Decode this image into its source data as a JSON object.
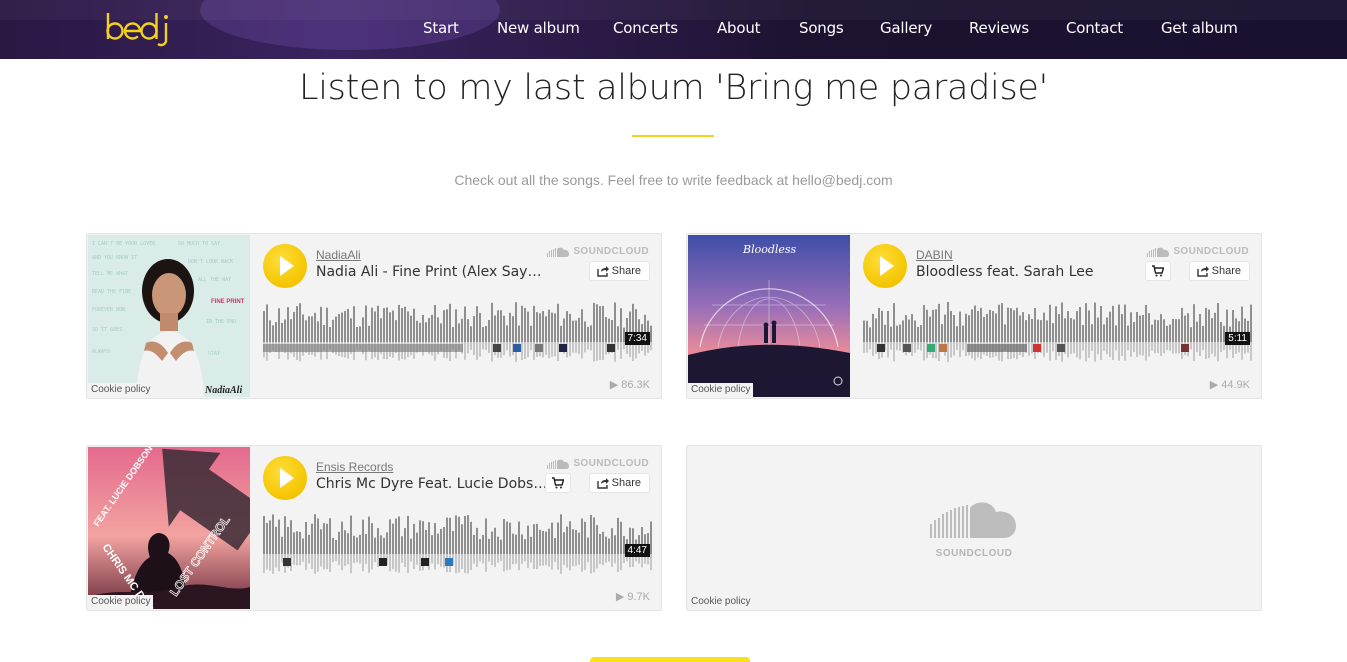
{
  "header": {
    "logo_text": "bedj",
    "nav": [
      "Start",
      "New album",
      "Concerts",
      "About",
      "Songs",
      "Gallery",
      "Reviews",
      "Contact",
      "Get album"
    ]
  },
  "section": {
    "title": "Listen to my last album 'Bring me paradise'",
    "subtitle": "Check out all the songs. Feel free to write feedback at hello@bedj.com"
  },
  "players": [
    {
      "artist": "NadiaAli",
      "track": "Nadia Ali - Fine Print (Alex Sayz Remix)",
      "duration": "7:34",
      "plays": "86.3K",
      "brand": "SOUNDCLOUD",
      "share_label": "Share",
      "cookie_label": "Cookie policy",
      "artwork_text": "FINE PRINT",
      "artwork_signature": "NadiaAli",
      "has_cart": false
    },
    {
      "artist": "DABIN",
      "track": "Bloodless feat. Sarah Lee",
      "duration": "5:11",
      "plays": "44.9K",
      "brand": "SOUNDCLOUD",
      "share_label": "Share",
      "cookie_label": "Cookie policy",
      "artwork_text": "Bloodless",
      "has_cart": true
    },
    {
      "artist": "Ensis Records",
      "track": "Chris Mc Dyre Feat. Lucie Dobson - Lost Control",
      "duration": "4:47",
      "plays": "9.7K",
      "brand": "SOUNDCLOUD",
      "share_label": "Share",
      "cookie_label": "Cookie policy",
      "artwork_text": [
        "FEAT. LUCIE DOBSON",
        "CHRIS MC DYRE",
        "LOST CONTROL"
      ],
      "has_cart": true
    }
  ],
  "placeholder_player": {
    "brand": "SOUNDCLOUD",
    "cookie_label": "Cookie policy"
  },
  "colors": {
    "accent": "#f4d21f",
    "nav_bg": "#2a1742",
    "play_button": "#f4c400"
  },
  "icons": [
    "soundcloud-icon",
    "share-icon",
    "cart-icon",
    "play-icon"
  ]
}
